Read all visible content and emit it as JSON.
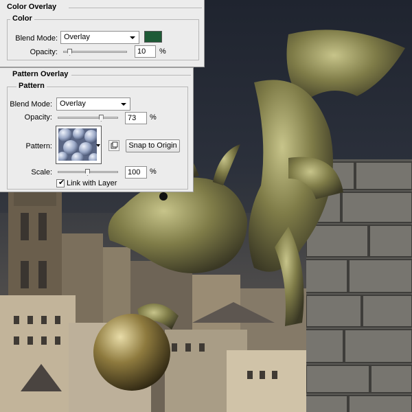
{
  "color_overlay": {
    "title": "Color Overlay",
    "section": "Color",
    "blend_mode_label": "Blend Mode:",
    "blend_mode": "Overlay",
    "swatch_color": "#1e5a36",
    "opacity_label": "Opacity:",
    "opacity": "10",
    "opacity_fraction": 0.1,
    "percent": "%"
  },
  "pattern_overlay": {
    "title": "Pattern Overlay",
    "section": "Pattern",
    "blend_mode_label": "Blend Mode:",
    "blend_mode": "Overlay",
    "opacity_label": "Opacity:",
    "opacity": "73",
    "opacity_fraction": 0.73,
    "pattern_label": "Pattern:",
    "pattern_icon": "bubbles-pattern-icon",
    "new_preset_icon": "new-preset-icon",
    "snap_button": "Snap to Origin",
    "scale_label": "Scale:",
    "scale": "100",
    "scale_fraction": 0.5,
    "link_label": "Link with Layer",
    "link_checked": true,
    "percent": "%"
  },
  "colors": {
    "panel_bg": "#ececec",
    "sky": "#262b36",
    "brick": "#6e6c68",
    "bronze": "#8a8850"
  }
}
